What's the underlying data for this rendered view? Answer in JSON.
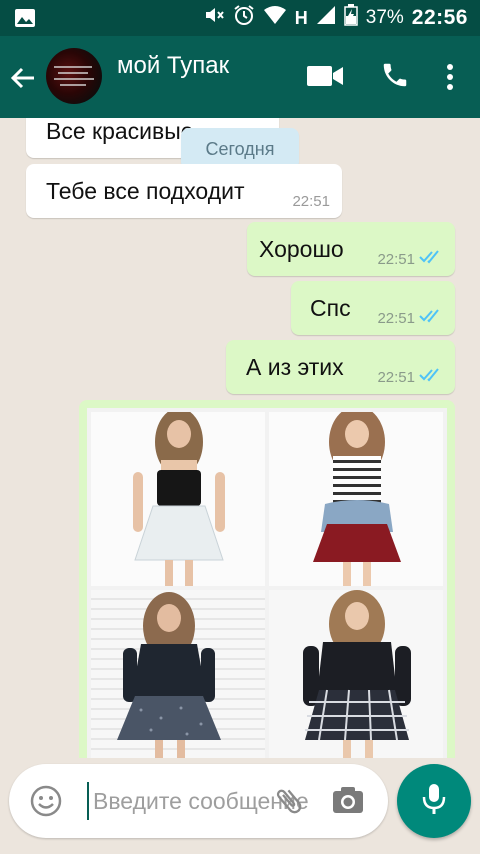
{
  "status_bar": {
    "battery": "37%",
    "network": "H",
    "time": "22:56"
  },
  "header": {
    "contact_name": "мой Тупак"
  },
  "chat": {
    "date_chip": "Сегодня",
    "messages": [
      {
        "direction": "in",
        "text": "Все красивые",
        "time": ""
      },
      {
        "direction": "in",
        "text": "Тебе все подходит",
        "time": "22:51"
      },
      {
        "direction": "out",
        "text": "Хорошо",
        "time": "22:51",
        "status": "read"
      },
      {
        "direction": "out",
        "text": "Спс",
        "time": "22:51",
        "status": "read"
      },
      {
        "direction": "out",
        "text": "А из этих",
        "time": "22:51",
        "status": "read"
      }
    ],
    "image_message": {
      "direction": "out",
      "images": 4
    }
  },
  "composer": {
    "placeholder": "Введите сообщение",
    "value": ""
  },
  "colors": {
    "toolbar": "#075e54",
    "status_bar": "#054d44",
    "outgoing_bubble": "#dcf8c6",
    "incoming_bubble": "#ffffff",
    "accent": "#00897b",
    "read_ticks": "#4fc3f7"
  },
  "icons": {
    "status_left": "image-icon",
    "status_right": [
      "mute-icon",
      "alarm-icon",
      "wifi-icon",
      "signal-icon",
      "battery-icon"
    ],
    "header": [
      "back-arrow-icon",
      "video-call-icon",
      "phone-icon",
      "more-vert-icon"
    ],
    "composer": [
      "emoji-icon",
      "attach-icon",
      "camera-icon",
      "mic-icon"
    ]
  }
}
